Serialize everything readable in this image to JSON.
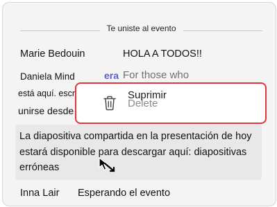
{
  "divider": {
    "label": "Te uniste al evento"
  },
  "messages": {
    "m1": {
      "sender": "Marie Bedouin",
      "text": "HOLA A TODOS!!"
    },
    "m2": {
      "sender": "Daniela Mind",
      "line2": "está aquí. escribe",
      "line3": "unirse desde",
      "fragment_brand": "era",
      "fragment_text": "For those who",
      "fragment_t": "t"
    },
    "selected": {
      "text": "La diapositiva compartida en la presentación de hoy estará disponible para descargar aquí: diapositivas erróneas"
    },
    "m4": {
      "sender": "Inna Lair",
      "text": "Esperando el evento"
    }
  },
  "context_menu": {
    "items": [
      {
        "label": "Suprimir",
        "icon": "trash-icon",
        "ghost_label": "Delete"
      }
    ]
  },
  "colors": {
    "menu_border": "#e2343f",
    "selected_bg": "#e8e8e8",
    "panel_bg": "#f4f4f4",
    "brand": "#5b5fc7"
  }
}
